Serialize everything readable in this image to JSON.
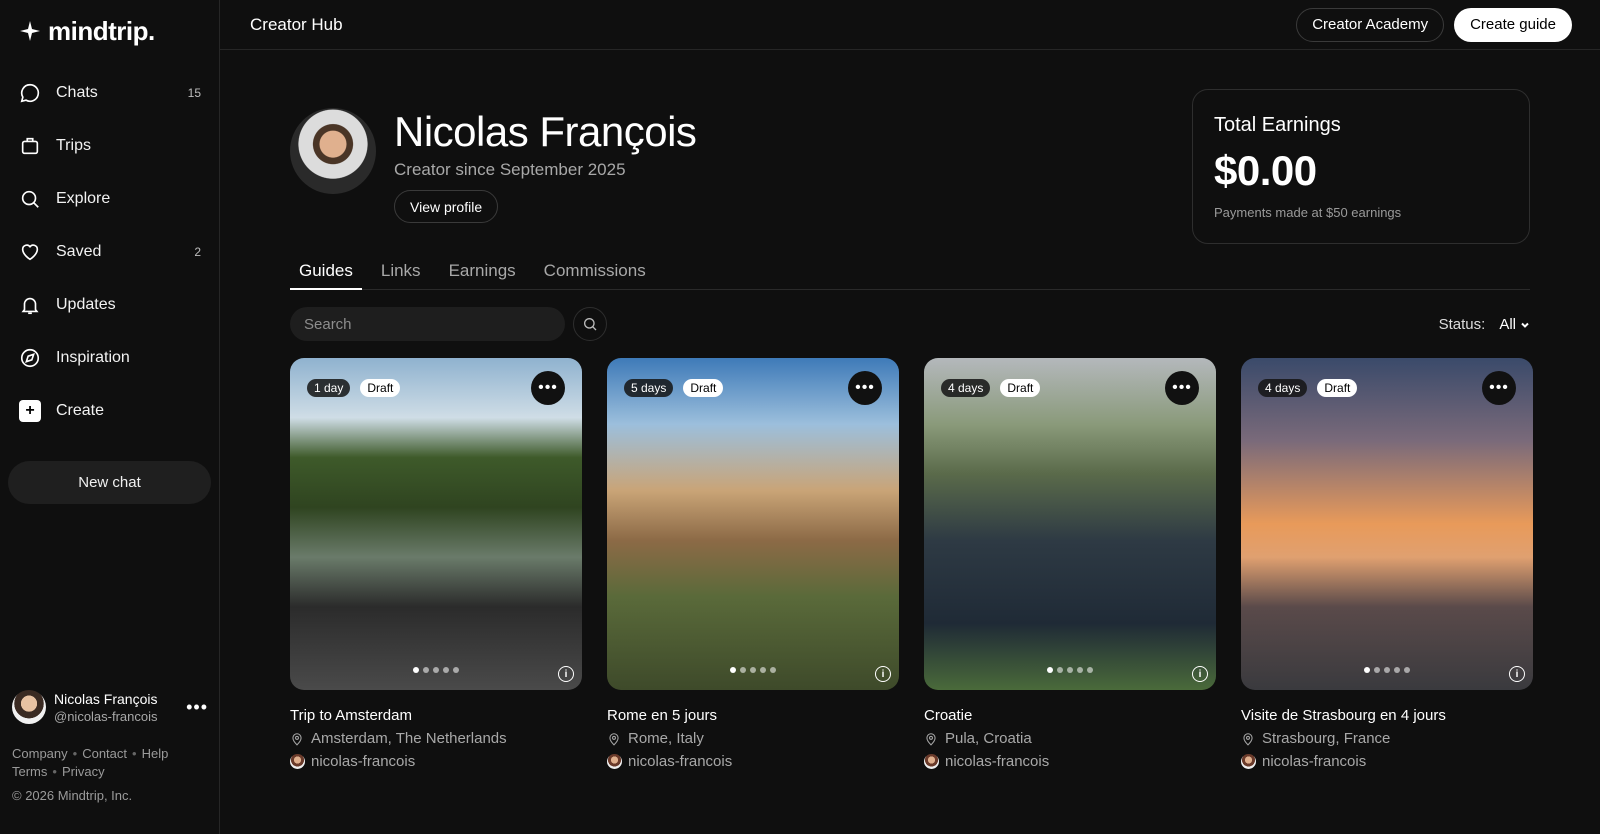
{
  "brand": {
    "name": "mindtrip."
  },
  "sidebar": {
    "items": [
      {
        "label": "Chats",
        "count": "15",
        "icon": "chat-bubble-icon"
      },
      {
        "label": "Trips",
        "count": "",
        "icon": "suitcase-icon"
      },
      {
        "label": "Explore",
        "count": "",
        "icon": "search-icon"
      },
      {
        "label": "Saved",
        "count": "2",
        "icon": "heart-icon"
      },
      {
        "label": "Updates",
        "count": "",
        "icon": "bell-icon"
      },
      {
        "label": "Inspiration",
        "count": "",
        "icon": "compass-icon"
      },
      {
        "label": "Create",
        "count": "",
        "icon": "plus-icon"
      }
    ],
    "new_chat": "New chat",
    "user": {
      "name": "Nicolas François",
      "handle": "@nicolas-francois"
    },
    "links": {
      "company": "Company",
      "contact": "Contact",
      "help": "Help",
      "terms": "Terms",
      "privacy": "Privacy"
    },
    "copyright": "© 2026 Mindtrip, Inc."
  },
  "topbar": {
    "title": "Creator Hub",
    "academy": "Creator Academy",
    "create_guide": "Create guide"
  },
  "profile": {
    "name": "Nicolas François",
    "since": "Creator since September 2025",
    "view_profile": "View profile"
  },
  "earnings": {
    "title": "Total Earnings",
    "value": "$0.00",
    "note": "Payments made at $50 earnings"
  },
  "tabs": [
    "Guides",
    "Links",
    "Earnings",
    "Commissions"
  ],
  "search": {
    "placeholder": "Search"
  },
  "status": {
    "label": "Status:",
    "value": "All"
  },
  "guides": [
    {
      "days": "1 day",
      "status": "Draft",
      "title": "Trip to Amsterdam",
      "location": "Amsterdam, The Netherlands",
      "author": "nicolas-francois"
    },
    {
      "days": "5 days",
      "status": "Draft",
      "title": "Rome en 5 jours",
      "location": "Rome, Italy",
      "author": "nicolas-francois"
    },
    {
      "days": "4 days",
      "status": "Draft",
      "title": "Croatie",
      "location": "Pula, Croatia",
      "author": "nicolas-francois"
    },
    {
      "days": "4 days",
      "status": "Draft",
      "title": "Visite de Strasbourg en 4 jours",
      "location": "Strasbourg, France",
      "author": "nicolas-francois"
    }
  ],
  "colors": {
    "background": "#0f0f0f",
    "border": "#262626",
    "text_muted": "#a8a8a8"
  }
}
